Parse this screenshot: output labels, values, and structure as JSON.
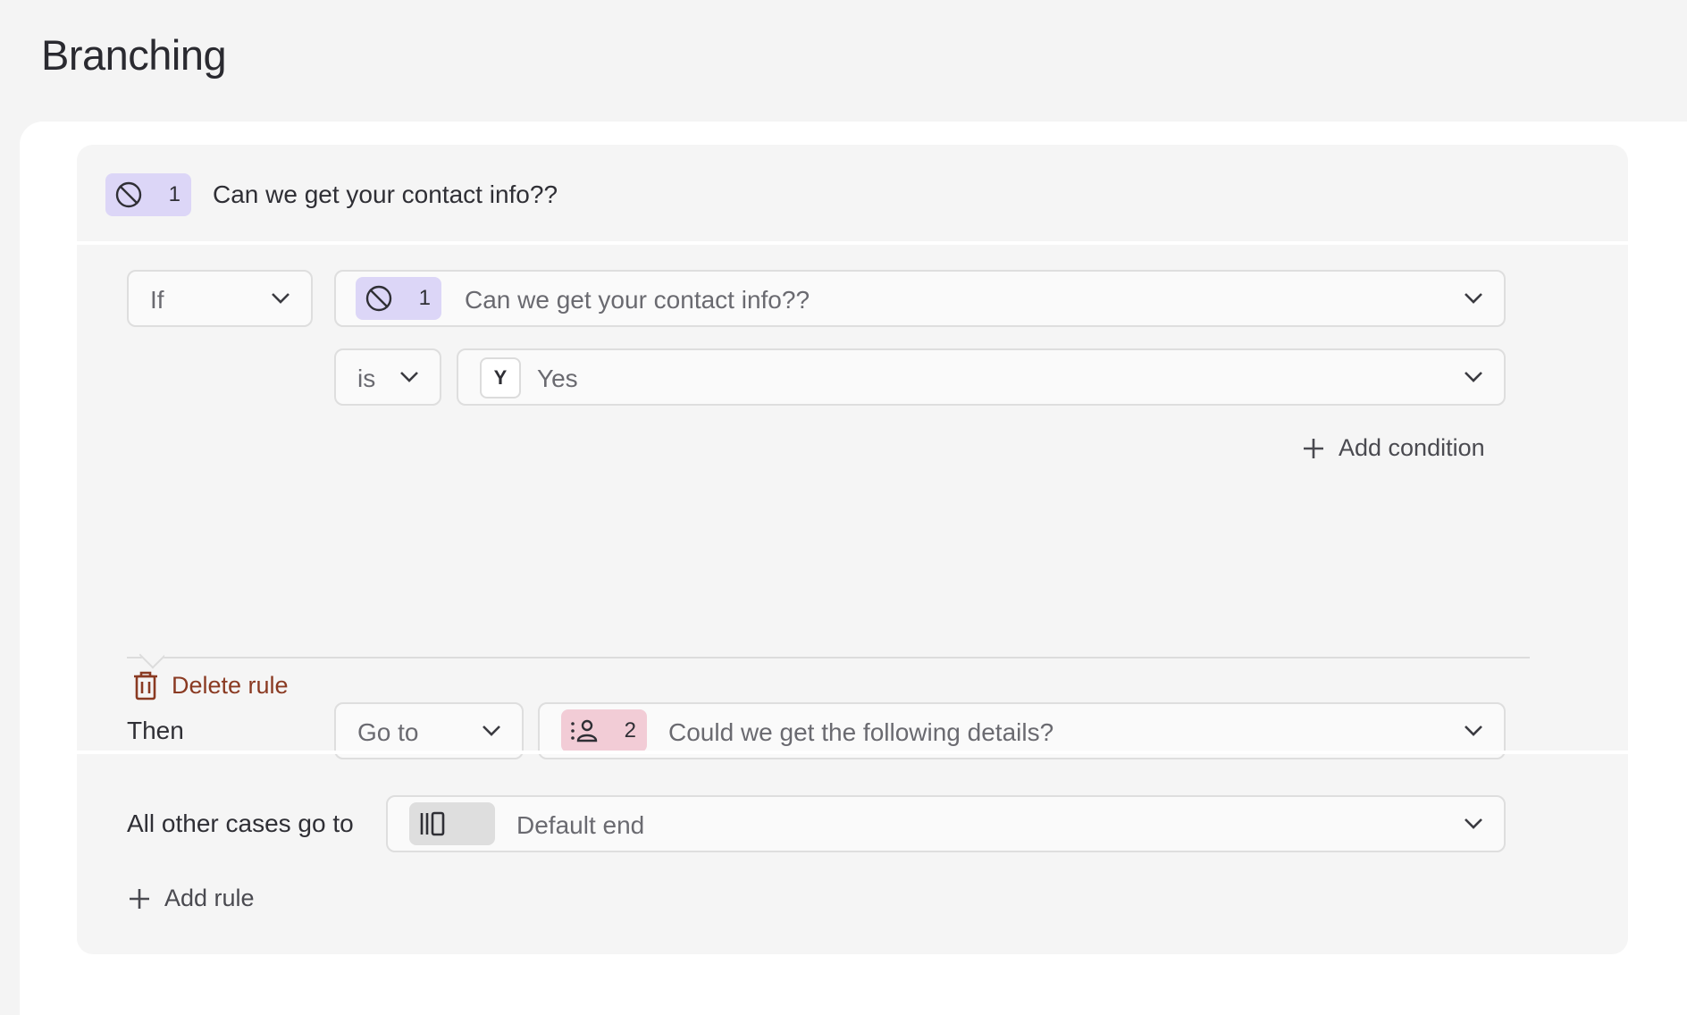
{
  "page": {
    "title": "Branching"
  },
  "header": {
    "question_number": "1",
    "question_icon": "ban-circle-icon",
    "question_title": "Can we get your contact info??"
  },
  "rule": {
    "if_select": "If",
    "condition_question": {
      "number": "1",
      "icon": "ban-circle-icon",
      "title": "Can we get your contact info??"
    },
    "operator_select": "is",
    "value": {
      "key": "Y",
      "label": "Yes"
    },
    "add_condition_label": "Add condition",
    "then_label": "Then",
    "action_select": "Go to",
    "target_question": {
      "number": "2",
      "icon": "contact-list-icon",
      "title": "Could we get the following details?"
    },
    "delete_label": "Delete rule"
  },
  "fallback": {
    "label": "All other cases go to",
    "target_icon": "end-screen-icon",
    "target_title": "Default end",
    "add_rule_label": "Add rule"
  },
  "colors": {
    "question_badge": "#dcd6f7",
    "contact_badge": "#f2ccd6",
    "end_badge": "#dedede",
    "delete": "#8a3a22"
  }
}
